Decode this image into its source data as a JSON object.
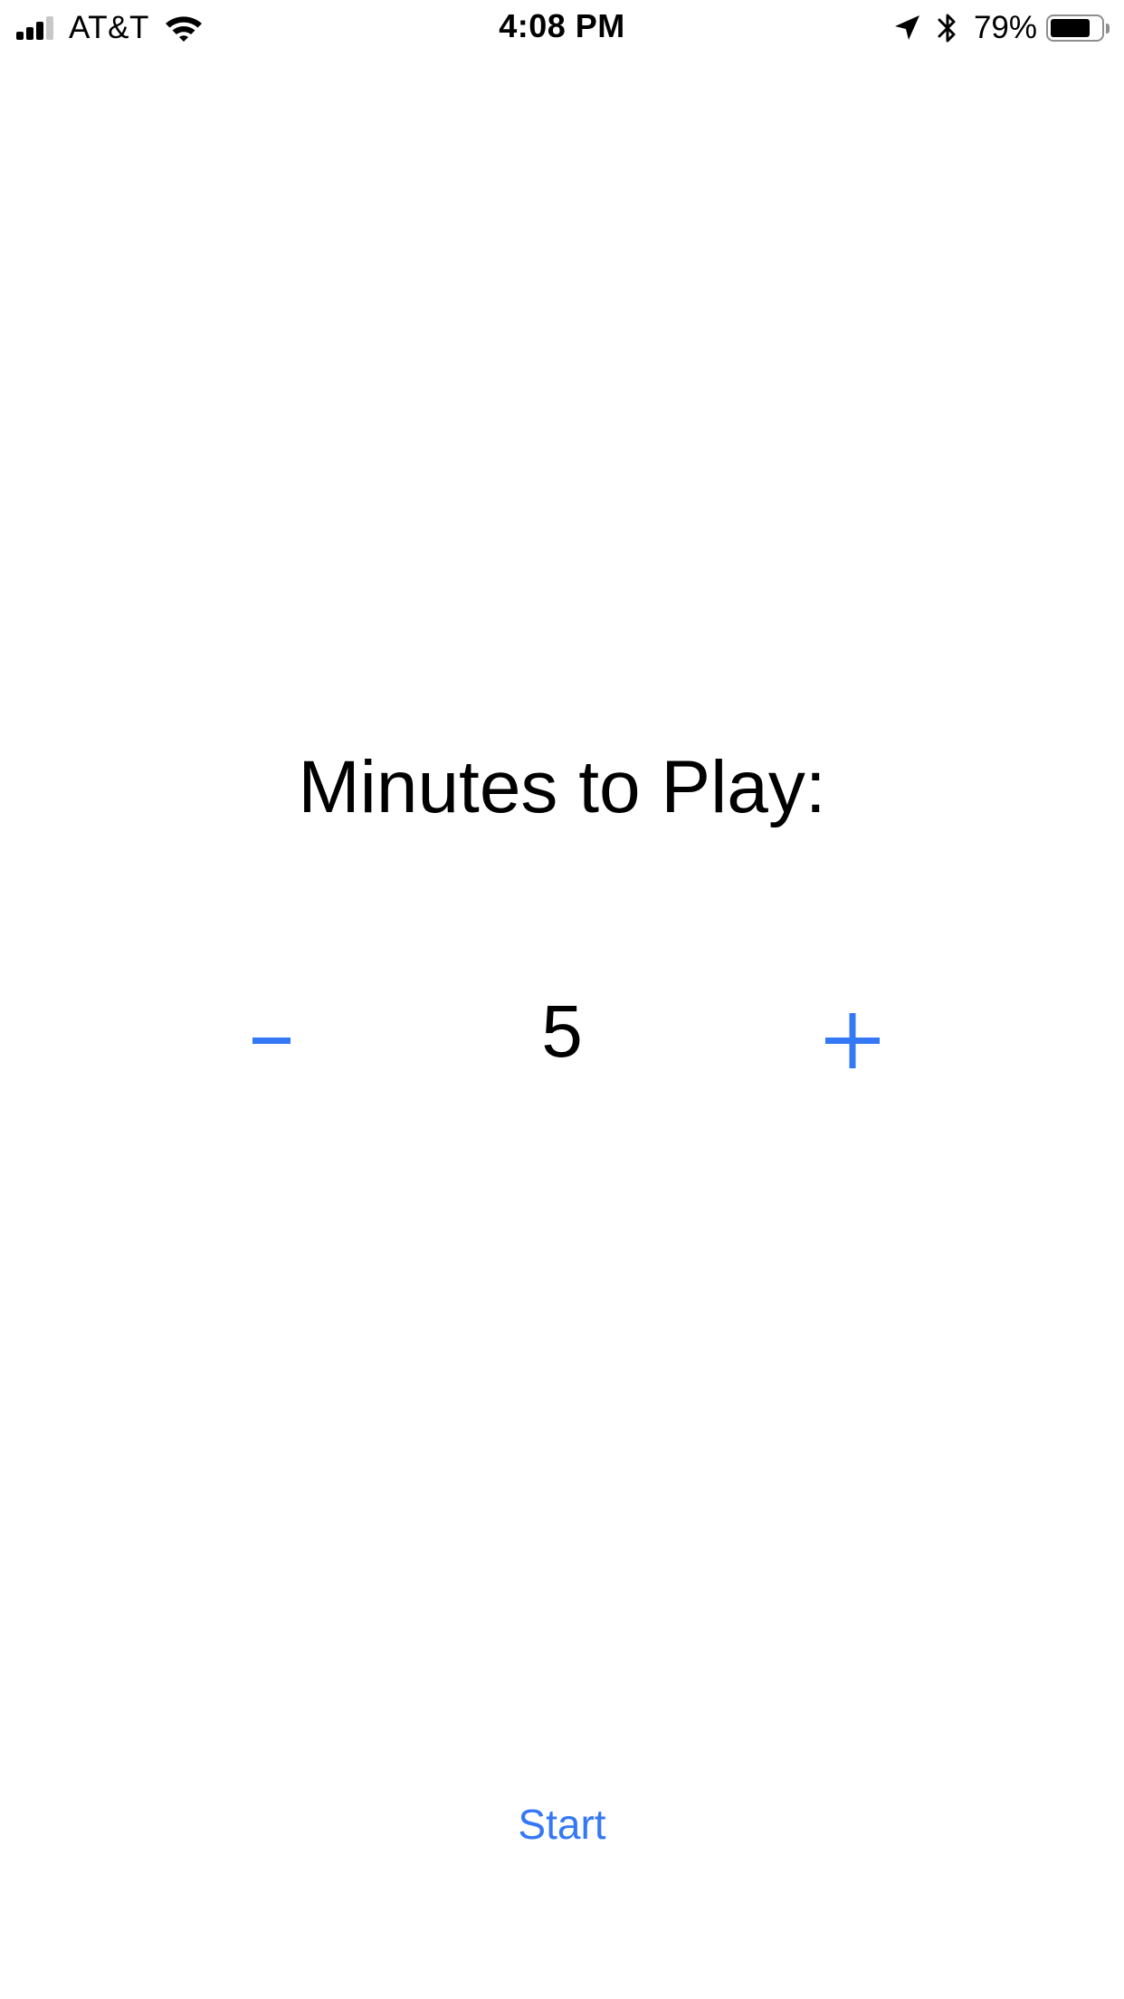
{
  "status_bar": {
    "carrier": "AT&T",
    "time": "4:08 PM",
    "battery_percent": "79%",
    "battery_level": 0.79,
    "signal_bars_filled": 3,
    "signal_bars_total": 4
  },
  "main": {
    "title": "Minutes to Play:",
    "minutes_value": "5",
    "decrement_label": "minus",
    "increment_label": "plus",
    "start_label": "Start"
  },
  "colors": {
    "accent": "#3478f6",
    "text": "#000000",
    "background": "#ffffff"
  },
  "icons": {
    "signal": "cellular-signal-icon",
    "wifi": "wifi-icon",
    "location": "location-arrow-icon",
    "bluetooth": "bluetooth-icon",
    "battery": "battery-icon",
    "minus": "minus-icon",
    "plus": "plus-icon"
  }
}
